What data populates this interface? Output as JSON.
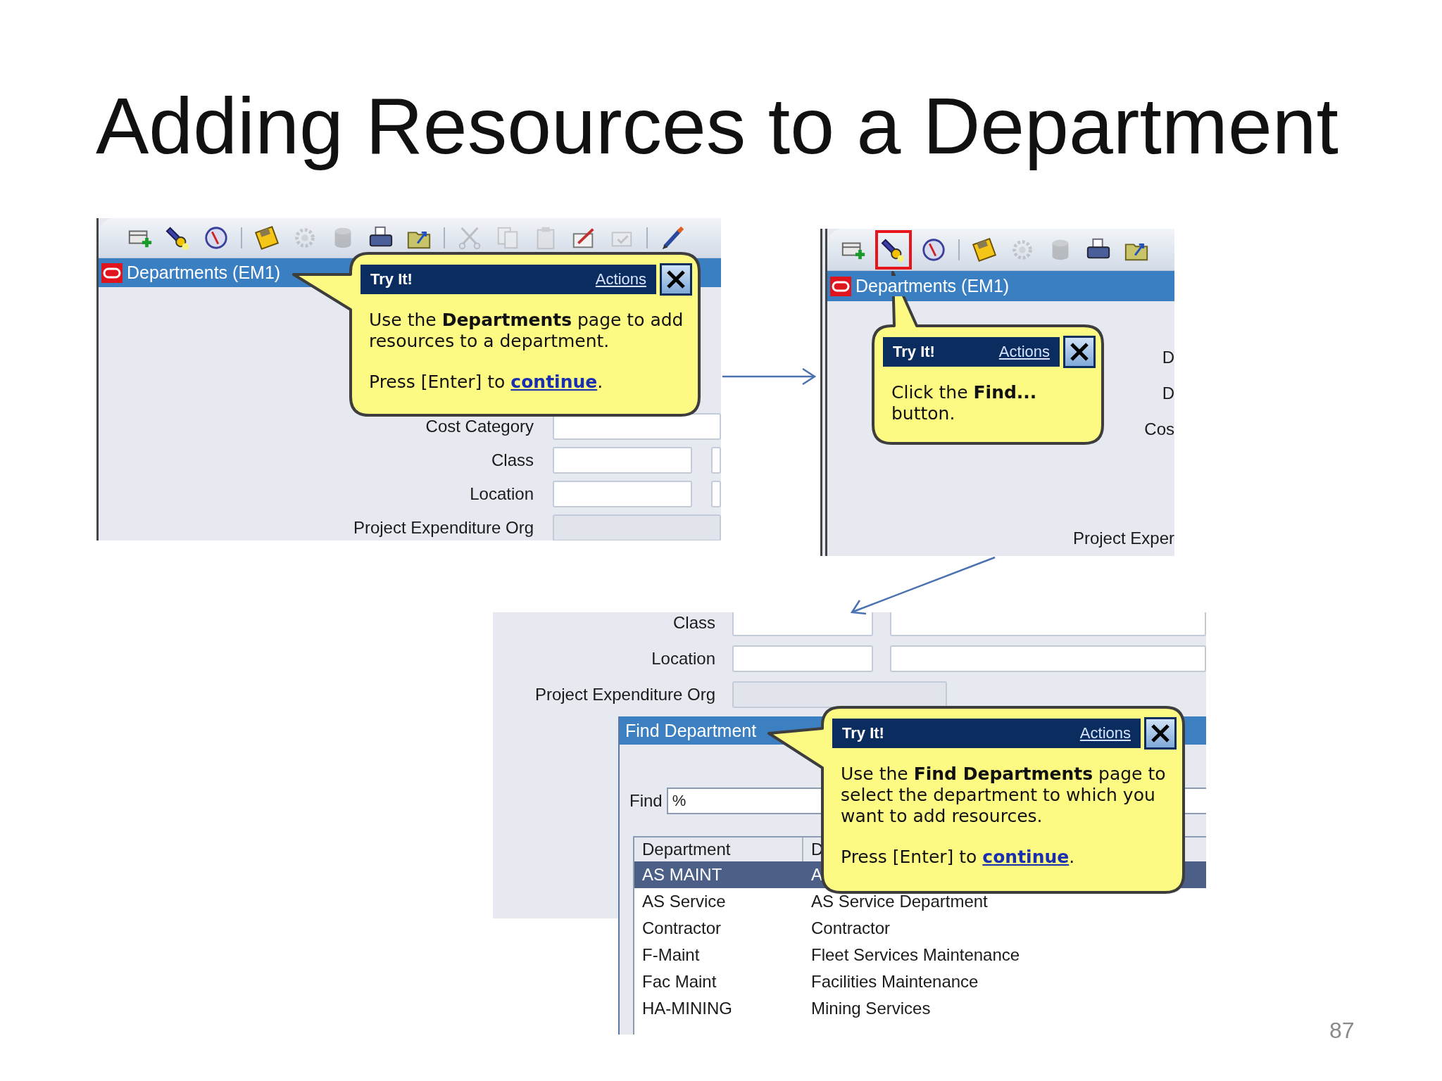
{
  "slide": {
    "title": "Adding Resources to a Department",
    "page_number": "87"
  },
  "panels": [
    {
      "kind": "main-form",
      "window_title": "Departments (EM1)",
      "toolbar": [
        {
          "kind": "new",
          "disabled": false
        },
        {
          "kind": "flashlight",
          "disabled": false
        },
        {
          "kind": "compass",
          "disabled": false
        },
        {
          "kind": "separator"
        },
        {
          "kind": "floppy",
          "disabled": false
        },
        {
          "kind": "gear",
          "disabled": true
        },
        {
          "kind": "cylinder",
          "disabled": true
        },
        {
          "kind": "printer",
          "disabled": false
        },
        {
          "kind": "folder",
          "disabled": false
        },
        {
          "kind": "separator"
        },
        {
          "kind": "scissors",
          "disabled": true
        },
        {
          "kind": "copy",
          "disabled": true
        },
        {
          "kind": "paste",
          "disabled": true
        },
        {
          "kind": "edit",
          "disabled": false
        },
        {
          "kind": "checkdoc",
          "disabled": true
        },
        {
          "kind": "separator"
        },
        {
          "kind": "pencil",
          "disabled": false
        }
      ],
      "fields": [
        {
          "label": "Cost Category",
          "kind": "wide"
        },
        {
          "label": "Class",
          "kind": "pair"
        },
        {
          "label": "Location",
          "kind": "pair"
        },
        {
          "label": "Project Expenditure Org",
          "kind": "readonly"
        }
      ],
      "callout": {
        "title": "Try It!",
        "actions": "Actions",
        "message": "Use the **Departments** page to add resources to a department.",
        "prompt": "Press [Enter] to ",
        "link": "continue",
        "prompt_end": "."
      }
    },
    {
      "kind": "toolbar-view",
      "window_title": "Departments (EM1)",
      "toolbar": [
        {
          "kind": "new",
          "disabled": false,
          "highlighted": false
        },
        {
          "kind": "flashlight",
          "disabled": false,
          "highlighted": true
        },
        {
          "kind": "compass",
          "disabled": false,
          "highlighted": false
        },
        {
          "kind": "separator"
        },
        {
          "kind": "floppy",
          "disabled": false,
          "highlighted": false
        },
        {
          "kind": "gear",
          "disabled": true,
          "highlighted": false
        },
        {
          "kind": "cylinder",
          "disabled": true,
          "highlighted": false
        },
        {
          "kind": "printer",
          "disabled": false,
          "highlighted": false
        },
        {
          "kind": "folder",
          "disabled": false,
          "highlighted": false
        }
      ],
      "side_labels": [
        "D",
        "D",
        "Cos",
        "Project Exper"
      ],
      "callout": {
        "title": "Try It!",
        "actions": "Actions",
        "message": "Click the **Find...** button."
      }
    },
    {
      "kind": "find-window",
      "fields": [
        {
          "label": "Class",
          "kind": "pair"
        },
        {
          "label": "Location",
          "kind": "pair"
        },
        {
          "label": "Project Expenditure Org",
          "kind": "readonly"
        }
      ],
      "dialog": {
        "title": "Find Department",
        "find_label": "Find",
        "find_value": "%",
        "columns": [
          "Department",
          "D"
        ],
        "rows": [
          {
            "cells": [
              "AS MAINT",
              "A"
            ],
            "selected": true
          },
          {
            "cells": [
              "AS Service",
              "AS Service Department"
            ],
            "selected": false
          },
          {
            "cells": [
              "Contractor",
              "Contractor"
            ],
            "selected": false
          },
          {
            "cells": [
              "F-Maint",
              "Fleet Services Maintenance"
            ],
            "selected": false
          },
          {
            "cells": [
              "Fac Maint",
              "Facilities Maintenance"
            ],
            "selected": false
          },
          {
            "cells": [
              "HA-MINING",
              "Mining Services"
            ],
            "selected": false
          }
        ]
      },
      "callout": {
        "title": "Try It!",
        "actions": "Actions",
        "message": "Use the **Find Departments** page to select the department to which you want to add resources.",
        "prompt": "Press [Enter] to ",
        "link": "continue",
        "prompt_end": "."
      }
    }
  ]
}
